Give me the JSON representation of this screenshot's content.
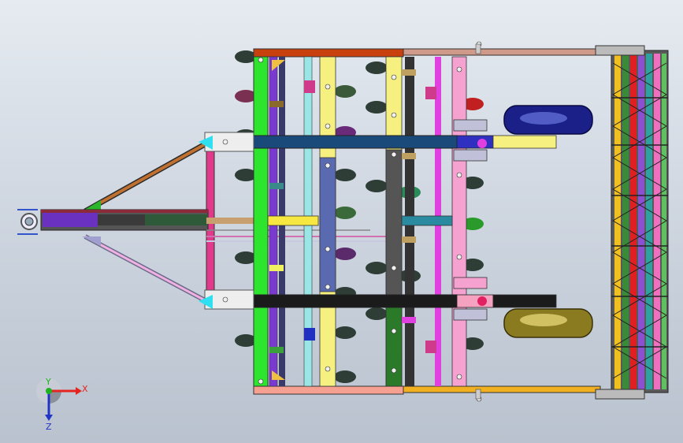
{
  "window": {
    "title": ""
  },
  "triad": {
    "x_label": "X",
    "y_label": "Y",
    "z_label": "Z",
    "x_color": "#e52420",
    "y_color": "#1fb11f",
    "z_color": "#2233c8"
  },
  "colors": {
    "background_top": "#e6ebf1",
    "background_bottom": "#b9c2ce",
    "frame_green": "#2ee52e",
    "frame_blue": "#1a4a7a",
    "beam_black": "#1b1b1b",
    "pink": "#f5a2d0",
    "tire": "#1a2088",
    "tire2": "#8a7a20",
    "disc": "#2e3d36"
  }
}
